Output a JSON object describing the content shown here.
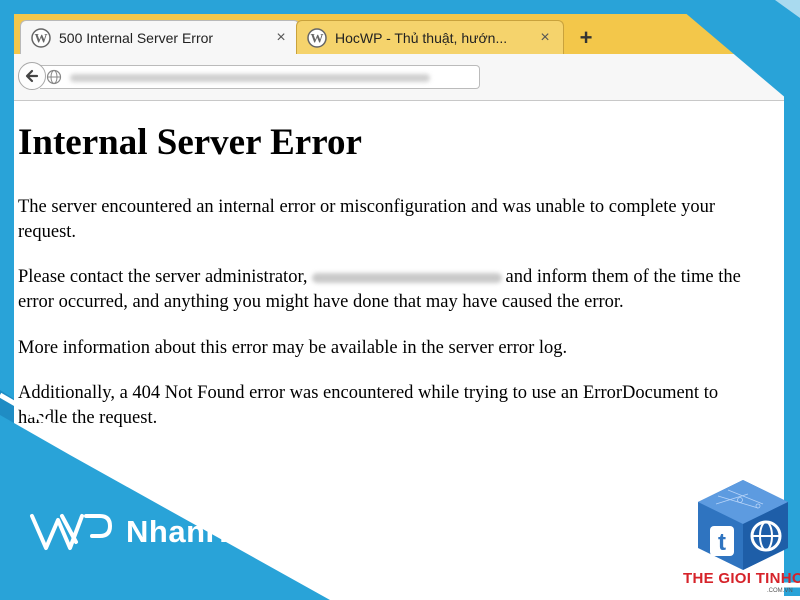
{
  "browser": {
    "tabs": [
      {
        "title": "500 Internal Server Error",
        "close": "×",
        "active": true
      },
      {
        "title": "HocWP - Thủ thuật, hướn...",
        "close": "×",
        "active": false
      }
    ],
    "new_tab": "+",
    "accent_color": "#f3c74a"
  },
  "page": {
    "heading": "Internal Server Error",
    "p1": "The server encountered an internal error or misconfiguration and was unable to complete your request.",
    "p2_before": "Please contact the server administrator,",
    "p2_after": "and inform them of the time the error occurred, and anything you might have done that may have caused the error.",
    "p3": "More information about this error may be available in the server error log.",
    "p4": "Additionally, a 404 Not Found error was encountered while trying to use an ErrorDocument to handle the request."
  },
  "branding": {
    "nhanhoa": "NhanHoa",
    "thegioitinhoc": "THE GIOI TINHOC",
    "thegioitinhoc_domain": ".COM.VN",
    "blue": "#29a3d8"
  }
}
